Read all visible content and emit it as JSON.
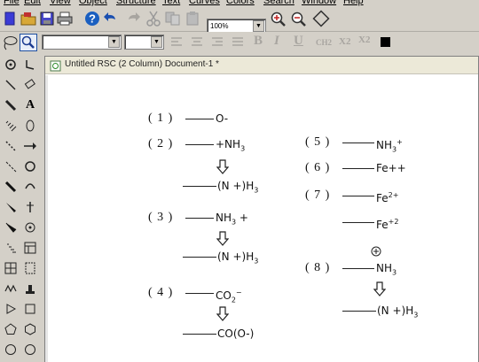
{
  "menu": [
    "File",
    "Edit",
    "View",
    "Object",
    "Structure",
    "Text",
    "Curves",
    "Colors",
    "Search",
    "Window",
    "Help"
  ],
  "toolbar": {
    "zoom_value": "100%",
    "format_buttons": [
      "B",
      "I",
      "U",
      "CH2",
      "X2",
      "X2"
    ]
  },
  "document": {
    "title": "Untitled RSC (2 Column) Document-1 *"
  },
  "structures": {
    "s1": {
      "label": "( 1 )",
      "group": "O-"
    },
    "s2": {
      "label": "( 2 )",
      "group": "+NH",
      "sub": "3"
    },
    "s2b": {
      "group": "(N +)H",
      "sub": "3"
    },
    "s3": {
      "label": "( 3 )",
      "group": "NH",
      "sub": "3",
      "tail": " +"
    },
    "s3b": {
      "group": "(N +)H",
      "sub": "3"
    },
    "s4": {
      "label": "( 4 )",
      "group": "CO",
      "sub": "2",
      "sup": "−"
    },
    "s4b": {
      "group": "CO(O-)"
    },
    "s5": {
      "label": "( 5 )",
      "group": "NH",
      "sub": "3",
      "sup": "+"
    },
    "s6": {
      "label": "( 6 )",
      "group": "Fe++"
    },
    "s7": {
      "label": "( 7 )",
      "group": "Fe",
      "sup": "2+"
    },
    "s7b": {
      "group": "Fe",
      "sup": "+2"
    },
    "s8": {
      "label": "( 8 )",
      "charge": "+",
      "group": "NH",
      "sub": "3"
    },
    "s8b": {
      "group": "(N +)H",
      "sub": "3"
    }
  }
}
